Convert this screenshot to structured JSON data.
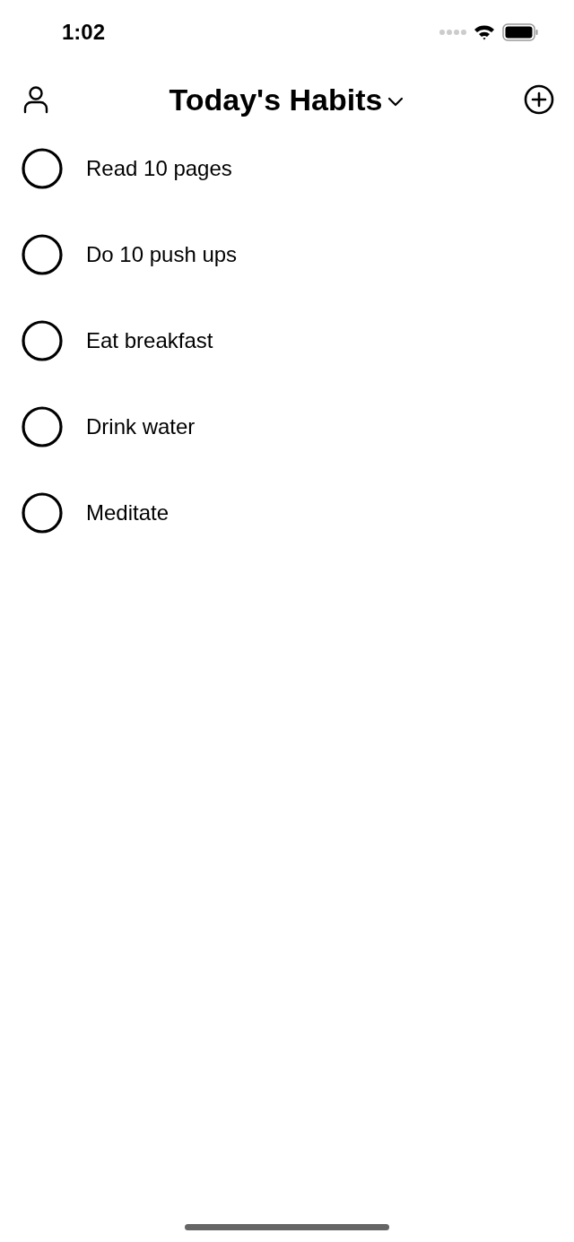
{
  "status_bar": {
    "time": "1:02"
  },
  "header": {
    "title": "Today's Habits"
  },
  "habits": [
    {
      "name": "Read 10 pages",
      "checked": false
    },
    {
      "name": "Do 10 push ups",
      "checked": false
    },
    {
      "name": "Eat breakfast",
      "checked": false
    },
    {
      "name": "Drink water",
      "checked": false
    },
    {
      "name": "Meditate",
      "checked": false
    }
  ]
}
